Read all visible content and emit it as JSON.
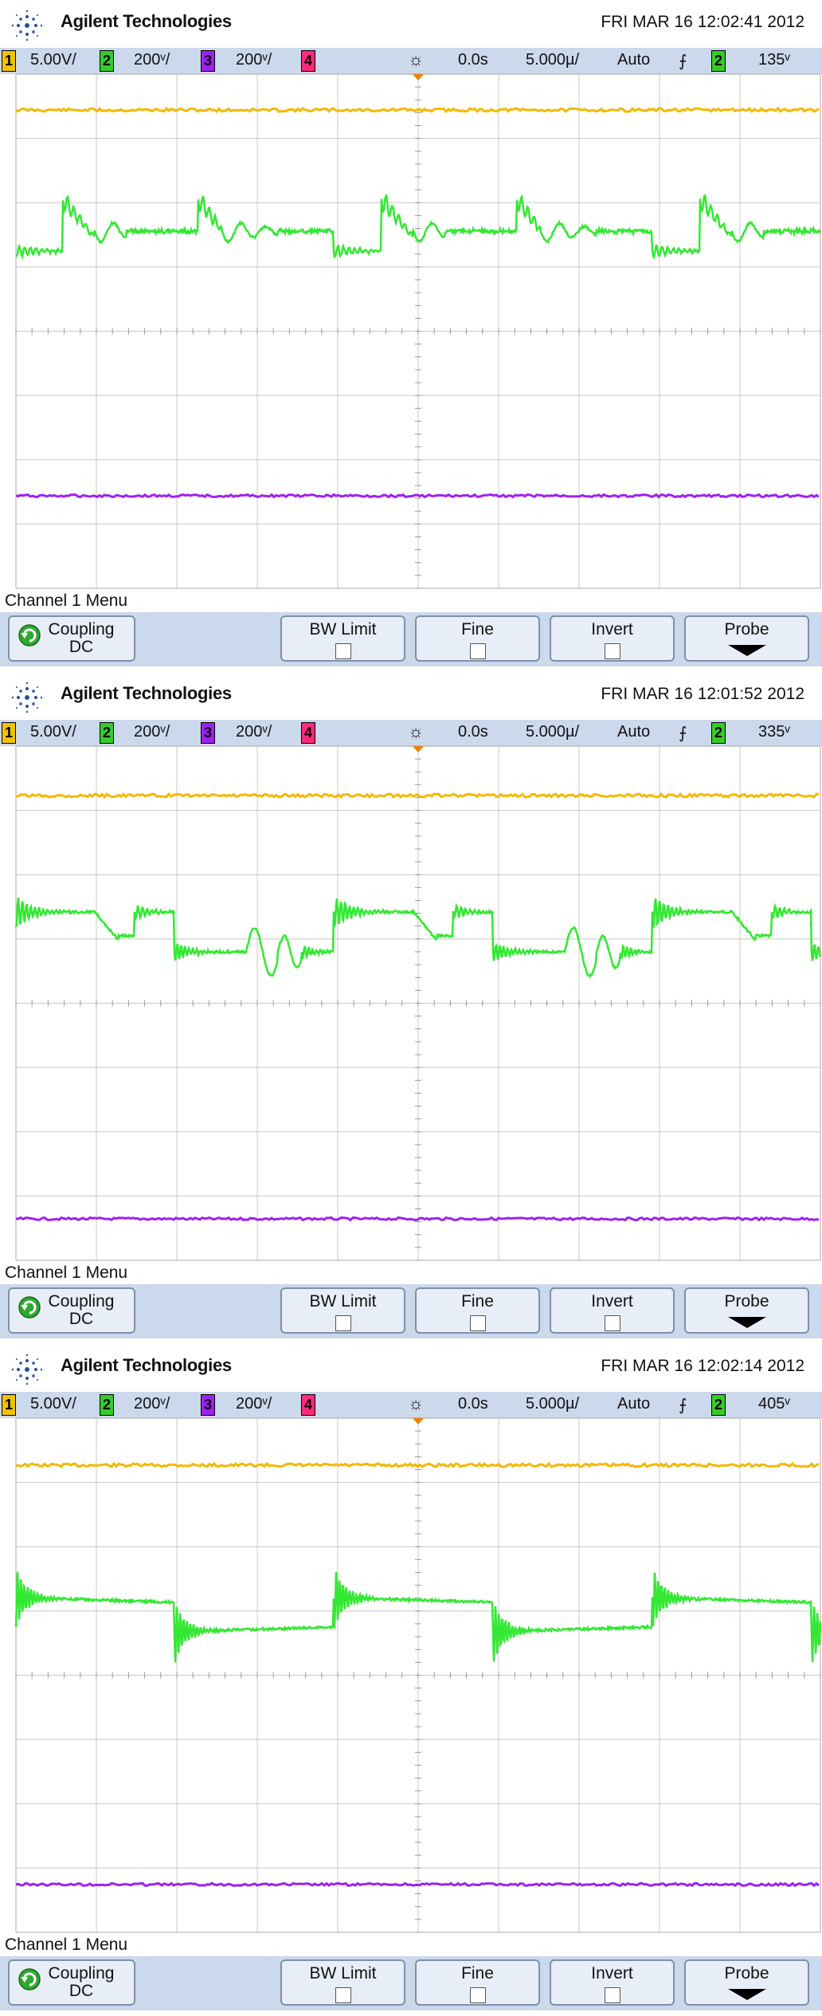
{
  "screens": [
    {
      "brand": "Agilent Technologies",
      "timestamp": "FRI MAR 16 12:02:41 2012",
      "status": {
        "ch1_num": "1",
        "ch1_scale": "5.00V/",
        "ch2_num": "2",
        "ch2_scale": "200ᵛ/",
        "ch3_num": "3",
        "ch3_scale": "200ᵛ/",
        "ch4_num": "4",
        "trig_icon": "☼",
        "delay": "0.0s",
        "timebase": "5.000µ/",
        "mode": "Auto",
        "slope": "⨍",
        "trig_src": "2",
        "trig_level": "135ᵛ"
      },
      "menu_title": "Channel 1  Menu",
      "keys": {
        "coupling": "Coupling",
        "coupling_value": "DC",
        "bw": "BW Limit",
        "fine": "Fine",
        "invert": "Invert",
        "probe": "Probe"
      },
      "wave": {
        "type": "scope-1"
      }
    },
    {
      "brand": "Agilent Technologies",
      "timestamp": "FRI MAR 16 12:01:52 2012",
      "status": {
        "ch1_num": "1",
        "ch1_scale": "5.00V/",
        "ch2_num": "2",
        "ch2_scale": "200ᵛ/",
        "ch3_num": "3",
        "ch3_scale": "200ᵛ/",
        "ch4_num": "4",
        "trig_icon": "☼",
        "delay": "0.0s",
        "timebase": "5.000µ/",
        "mode": "Auto",
        "slope": "⨍",
        "trig_src": "2",
        "trig_level": "335ᵛ"
      },
      "menu_title": "Channel 1  Menu",
      "keys": {
        "coupling": "Coupling",
        "coupling_value": "DC",
        "bw": "BW Limit",
        "fine": "Fine",
        "invert": "Invert",
        "probe": "Probe"
      },
      "wave": {
        "type": "scope-2"
      }
    },
    {
      "brand": "Agilent Technologies",
      "timestamp": "FRI MAR 16 12:02:14 2012",
      "status": {
        "ch1_num": "1",
        "ch1_scale": "5.00V/",
        "ch2_num": "2",
        "ch2_scale": "200ᵛ/",
        "ch3_num": "3",
        "ch3_scale": "200ᵛ/",
        "ch4_num": "4",
        "trig_icon": "☼",
        "delay": "0.0s",
        "timebase": "5.000µ/",
        "mode": "Auto",
        "slope": "⨍",
        "trig_src": "2",
        "trig_level": "405ᵛ"
      },
      "menu_title": "Channel 1  Menu",
      "keys": {
        "coupling": "Coupling",
        "coupling_value": "DC",
        "bw": "BW Limit",
        "fine": "Fine",
        "invert": "Invert",
        "probe": "Probe"
      },
      "wave": {
        "type": "scope-3"
      }
    }
  ],
  "colors": {
    "ch1": "#f5b800",
    "ch2": "#33e833",
    "ch3": "#a020f0",
    "grid": "#c8c8c8",
    "status_bg": "#ccd8ec"
  }
}
